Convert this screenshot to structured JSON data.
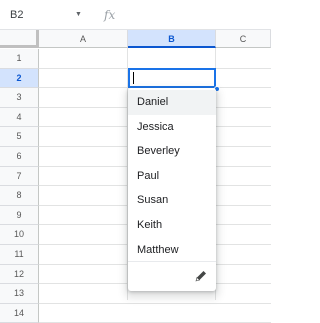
{
  "formula_bar": {
    "name_box": "B2",
    "name_box_arrow_icon": "triangle-down-icon",
    "fx_label": "fx",
    "formula_value": ""
  },
  "columns": [
    {
      "label": "A",
      "selected": false
    },
    {
      "label": "B",
      "selected": true
    },
    {
      "label": "C",
      "selected": false
    }
  ],
  "rows": [
    {
      "label": "1",
      "selected": false
    },
    {
      "label": "2",
      "selected": true
    },
    {
      "label": "3",
      "selected": false
    },
    {
      "label": "4",
      "selected": false
    },
    {
      "label": "5",
      "selected": false
    },
    {
      "label": "6",
      "selected": false
    },
    {
      "label": "7",
      "selected": false
    },
    {
      "label": "8",
      "selected": false
    },
    {
      "label": "9",
      "selected": false
    },
    {
      "label": "10",
      "selected": false
    },
    {
      "label": "11",
      "selected": false
    },
    {
      "label": "12",
      "selected": false
    },
    {
      "label": "13",
      "selected": false
    },
    {
      "label": "14",
      "selected": false
    }
  ],
  "active_cell": {
    "ref": "B2",
    "value": ""
  },
  "dropdown": {
    "options": [
      "Daniel",
      "Jessica",
      "Beverley",
      "Paul",
      "Susan",
      "Keith",
      "Matthew"
    ],
    "highlighted_index": 0,
    "edit_icon": "pencil-icon"
  },
  "colors": {
    "accent": "#1a73e8",
    "selected_header_bg": "#d3e3fd",
    "selected_header_text": "#0b57d0"
  }
}
